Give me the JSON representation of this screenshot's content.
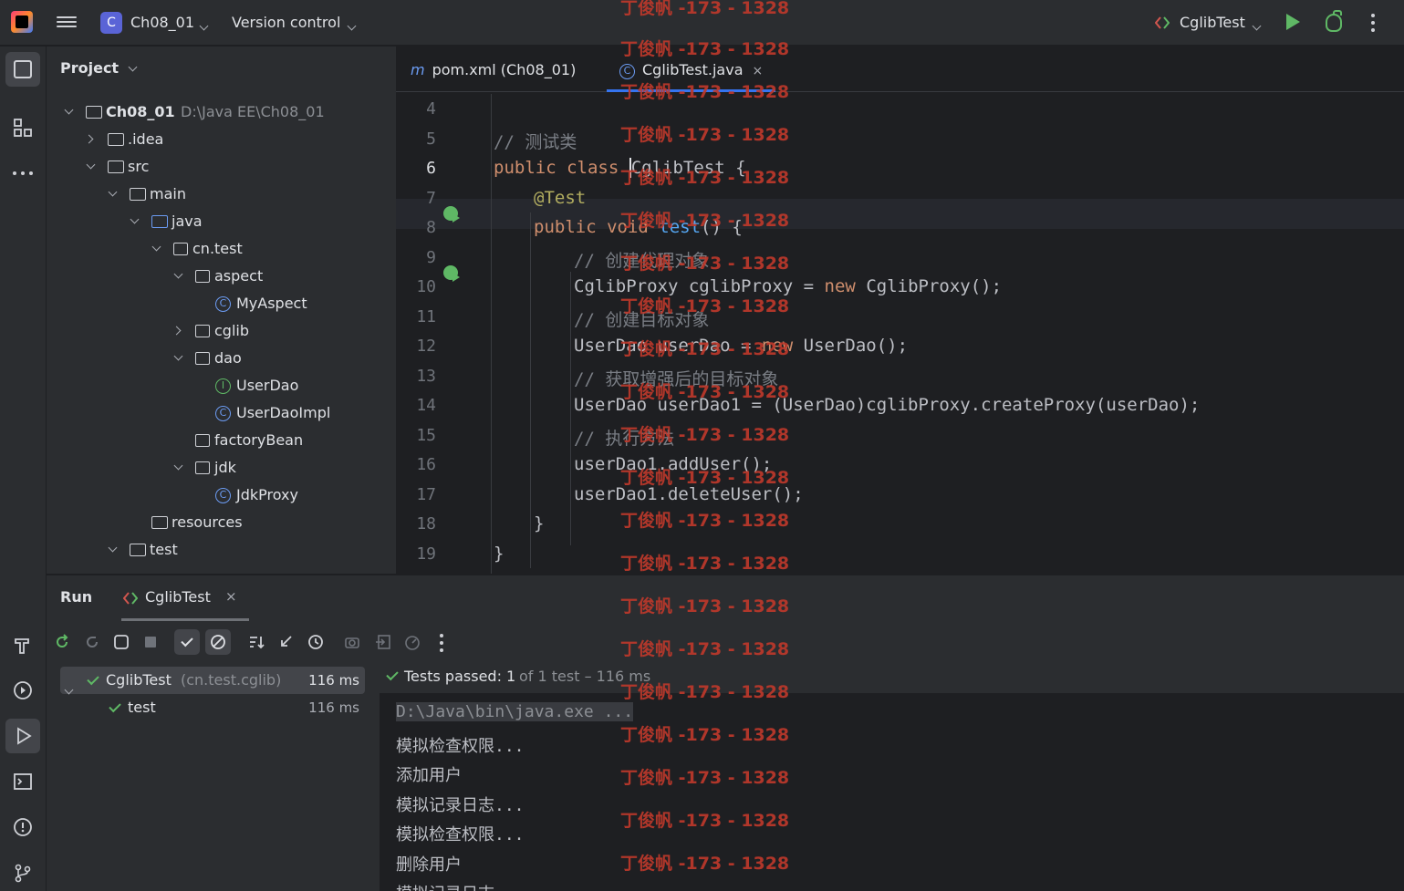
{
  "titlebar": {
    "project_badge": "C",
    "project_name": "Ch08_01",
    "vcs_label": "Version control",
    "run_config": "CglibTest"
  },
  "project_panel": {
    "title": "Project",
    "tree": [
      {
        "label": "Ch08_01",
        "path": "D:\\Java EE\\Ch08_01"
      },
      {
        "label": ".idea"
      },
      {
        "label": "src"
      },
      {
        "label": "main"
      },
      {
        "label": "java"
      },
      {
        "label": "cn.test"
      },
      {
        "label": "aspect"
      },
      {
        "label": "MyAspect"
      },
      {
        "label": "cglib"
      },
      {
        "label": "dao"
      },
      {
        "label": "UserDao"
      },
      {
        "label": "UserDaoImpl"
      },
      {
        "label": "factoryBean"
      },
      {
        "label": "jdk"
      },
      {
        "label": "JdkProxy"
      },
      {
        "label": "resources"
      },
      {
        "label": "test"
      }
    ]
  },
  "editor": {
    "tabs": [
      {
        "label": "pom.xml (Ch08_01)",
        "icon": "m"
      },
      {
        "label": "CglibTest.java",
        "icon": "C",
        "close": "×"
      }
    ],
    "lines": [
      {
        "n": "4"
      },
      {
        "n": "5"
      },
      {
        "n": "6"
      },
      {
        "n": "7"
      },
      {
        "n": "8"
      },
      {
        "n": "9"
      },
      {
        "n": "10"
      },
      {
        "n": "11"
      },
      {
        "n": "12"
      },
      {
        "n": "13"
      },
      {
        "n": "14"
      },
      {
        "n": "15"
      },
      {
        "n": "16"
      },
      {
        "n": "17"
      },
      {
        "n": "18"
      },
      {
        "n": "19"
      }
    ],
    "code": {
      "l5_comment": "// 测试类",
      "l6_kw": "public class ",
      "l6_name": "CglibTest",
      "l6_rest": " {",
      "l7": "@Test",
      "l8_kw": "public void ",
      "l8_fn": "test",
      "l8_rest": "() {",
      "l9": "// 创建代理对象",
      "l10_a": "CglibProxy cglibProxy = ",
      "l10_kw": "new",
      "l10_b": " CglibProxy();",
      "l11": "// 创建目标对象",
      "l12_a": "UserDao userDao = ",
      "l12_kw": "new",
      "l12_b": " UserDao();",
      "l13": "// 获取增强后的目标对象",
      "l14": "UserDao userDao1 = (UserDao)cglibProxy.createProxy(userDao);",
      "l15": "// 执行方法",
      "l16": "userDao1.addUser();",
      "l17": "userDao1.deleteUser();",
      "l18": "}",
      "l19": "}"
    }
  },
  "run_panel": {
    "title": "Run",
    "tab_label": "CglibTest",
    "tab_close": "×",
    "test_tree": [
      {
        "name": "CglibTest",
        "pkg": "(cn.test.cglib)",
        "duration": "116 ms"
      },
      {
        "name": "test",
        "duration": "116 ms"
      }
    ],
    "status": "Tests passed: 1",
    "status_detail": "of 1 test – 116 ms",
    "console": [
      "D:\\Java\\bin\\java.exe ...",
      "模拟检查权限...",
      "添加用户",
      "模拟记录日志...",
      "模拟检查权限...",
      "删除用户",
      "模拟记录日志..."
    ]
  },
  "watermark": "丁俊帆 -173 - 1328",
  "colors": {
    "accent": "#3574f0",
    "success": "#5fb865",
    "watermark": "#c0392b"
  }
}
